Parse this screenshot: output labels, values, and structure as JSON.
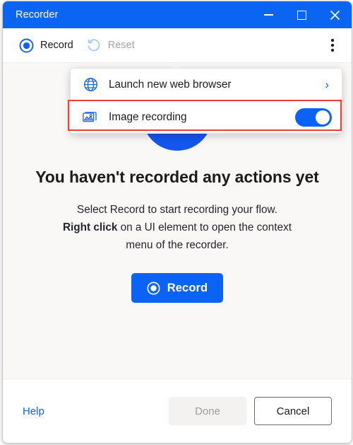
{
  "window": {
    "title": "Recorder",
    "caption": {
      "minimize": "minimize-icon",
      "maximize": "maximize-icon",
      "close": "close-icon"
    }
  },
  "toolbar": {
    "record_label": "Record",
    "record_icon": "record-target-icon",
    "reset_label": "Reset",
    "reset_icon": "reset-undo-icon",
    "reset_disabled": true,
    "more_icon": "more-vertical-icon"
  },
  "menu": {
    "items": [
      {
        "label": "Launch new web browser",
        "icon": "globe-icon",
        "trailing": "chevron-right-icon",
        "trailing_glyph": "›"
      },
      {
        "label": "Image recording",
        "icon": "image-icon",
        "trailing": "toggle-switch",
        "toggle_on": true,
        "highlighted": true
      }
    ]
  },
  "content": {
    "illustration_name": "empty-state-recorder-illustration",
    "headline": "You haven't recorded any actions yet",
    "body_line1": "Select Record to start recording your flow.",
    "body_line2_bold": "Right click",
    "body_line2_rest": " on a UI element to open the context",
    "body_line3": "menu of the recorder.",
    "record_button_label": "Record",
    "record_button_icon": "record-target-icon"
  },
  "footer": {
    "help_label": "Help",
    "done_label": "Done",
    "done_disabled": true,
    "cancel_label": "Cancel"
  },
  "colors": {
    "titlebar_blue": "#0A66F2",
    "accent_blue": "#0A63F5",
    "illustration_blue": "#1456EE",
    "highlight_red": "#EF4036",
    "content_bg": "#F9F8F7",
    "disabled_text": "#A19F9D",
    "link_blue": "#0B63F3"
  }
}
